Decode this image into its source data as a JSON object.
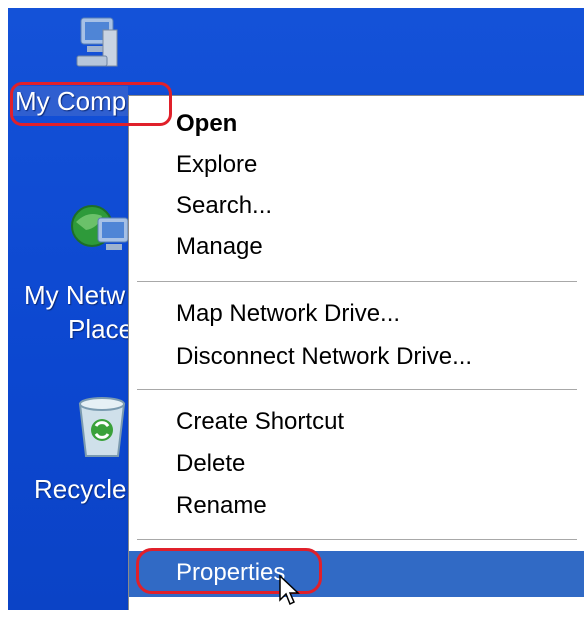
{
  "desktop": {
    "icons": [
      {
        "label": "My Comp",
        "icon": "my-computer-icon"
      },
      {
        "label_line1": "My Netw",
        "label_line2": "Place",
        "icon": "my-network-places-icon"
      },
      {
        "label": "Recycle",
        "icon": "recycle-bin-icon"
      }
    ]
  },
  "context_menu": {
    "items": [
      {
        "label": "Open",
        "default": true
      },
      {
        "label": "Explore"
      },
      {
        "label": "Search..."
      },
      {
        "label": "Manage"
      },
      {
        "label": "Map Network Drive..."
      },
      {
        "label": "Disconnect Network Drive..."
      },
      {
        "label": "Create Shortcut"
      },
      {
        "label": "Delete"
      },
      {
        "label": "Rename"
      },
      {
        "label": "Properties",
        "highlighted": true
      }
    ]
  },
  "colors": {
    "desktop": "#0e4dd9",
    "menu_highlight": "#316ac5",
    "annotation": "#e0202a"
  }
}
